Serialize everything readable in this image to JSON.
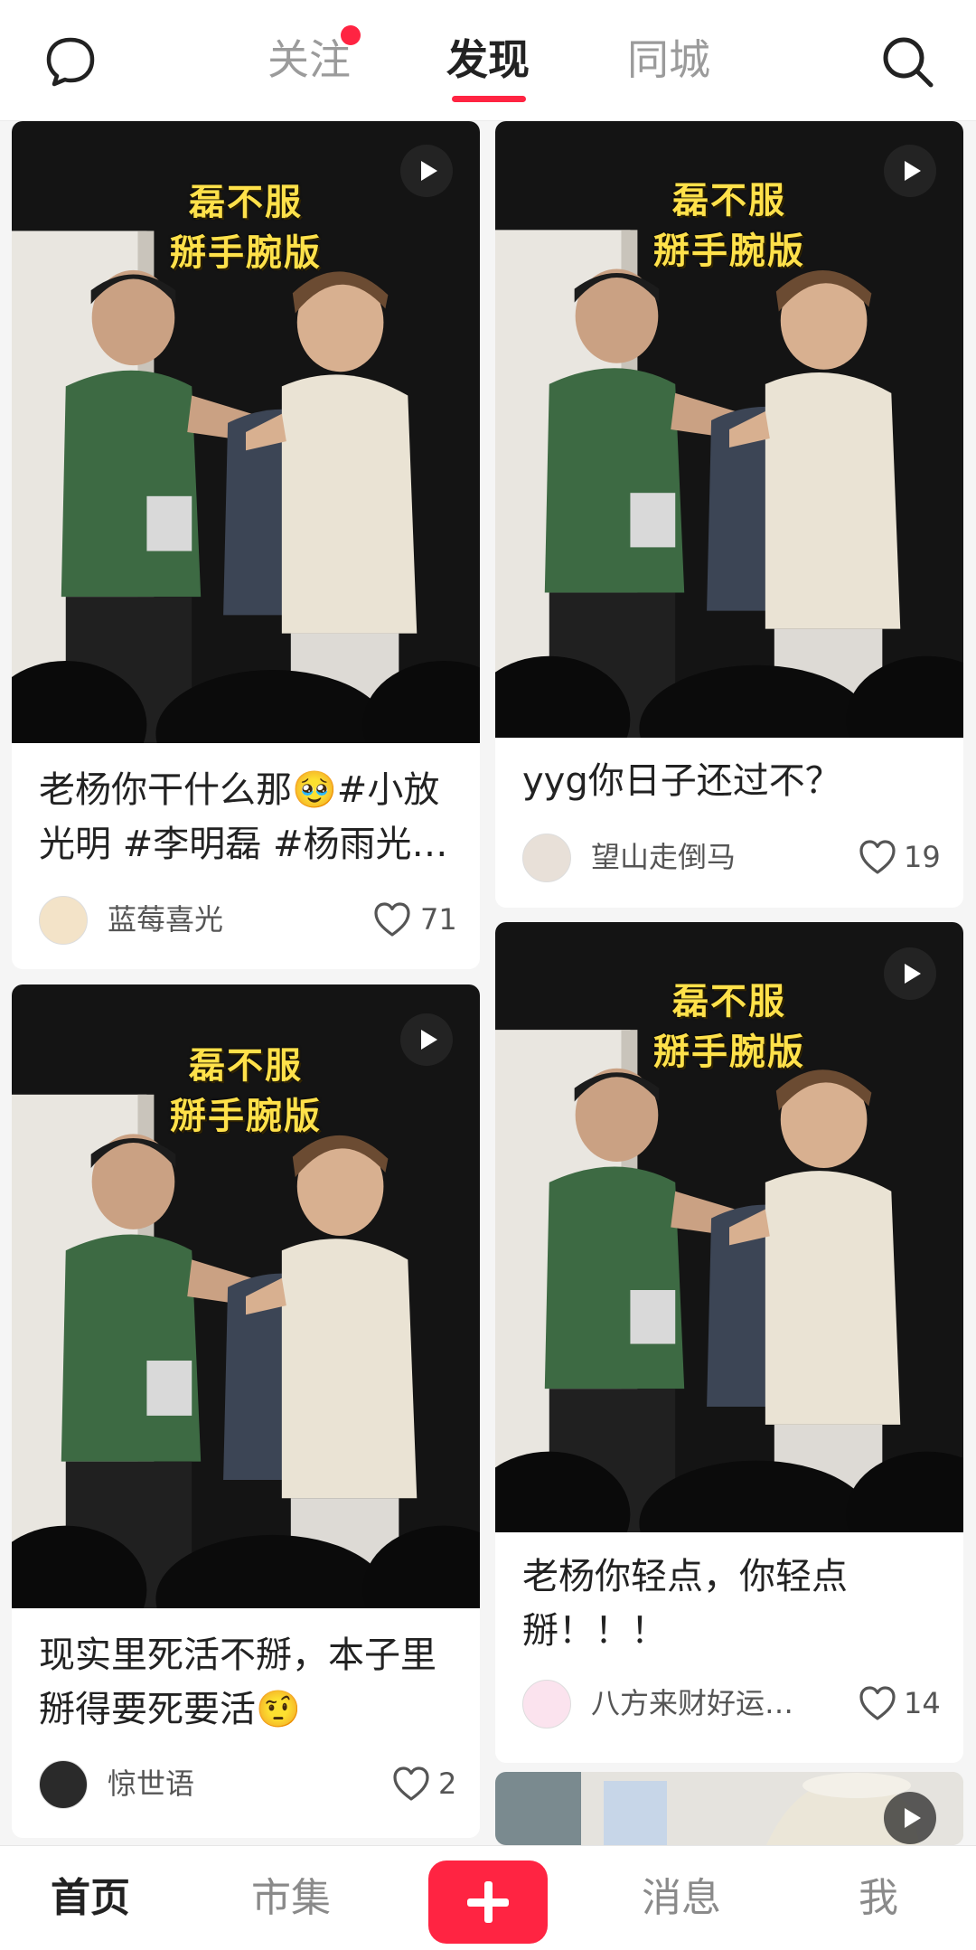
{
  "header": {
    "tabs": [
      {
        "label": "关注",
        "has_dot": true
      },
      {
        "label": "发现",
        "active": true
      },
      {
        "label": "同城"
      }
    ],
    "left_icon": "chat-bubble-icon",
    "right_icon": "search-icon",
    "accent_color": "#ff2442"
  },
  "feed": {
    "cards": [
      {
        "overlay_line1": "磊不服",
        "overlay_line2": "掰手腕版",
        "title": "老杨你干什么那🥹#小放光明 #李明磊 #杨雨光…",
        "author": "蓝莓喜光",
        "likes": "71"
      },
      {
        "overlay_line1": "磊不服",
        "overlay_line2": "掰手腕版",
        "title": "yyg你日子还过不？",
        "author": "望山走倒马",
        "likes": "19"
      },
      {
        "overlay_line1": "磊不服",
        "overlay_line2": "掰手腕版",
        "title": "现实里死活不掰，本子里掰得要死要活🤨",
        "author": "惊世语",
        "likes": "2"
      },
      {
        "overlay_line1": "磊不服",
        "overlay_line2": "掰手腕版",
        "title": "老杨你轻点，你轻点掰！！！",
        "author": "八方来财好运…",
        "likes": "14"
      }
    ]
  },
  "bottom_nav": {
    "items": [
      {
        "label": "首页",
        "active": true
      },
      {
        "label": "市集"
      },
      {
        "label": "消息"
      },
      {
        "label": "我"
      }
    ],
    "add_icon": "plus-icon"
  }
}
